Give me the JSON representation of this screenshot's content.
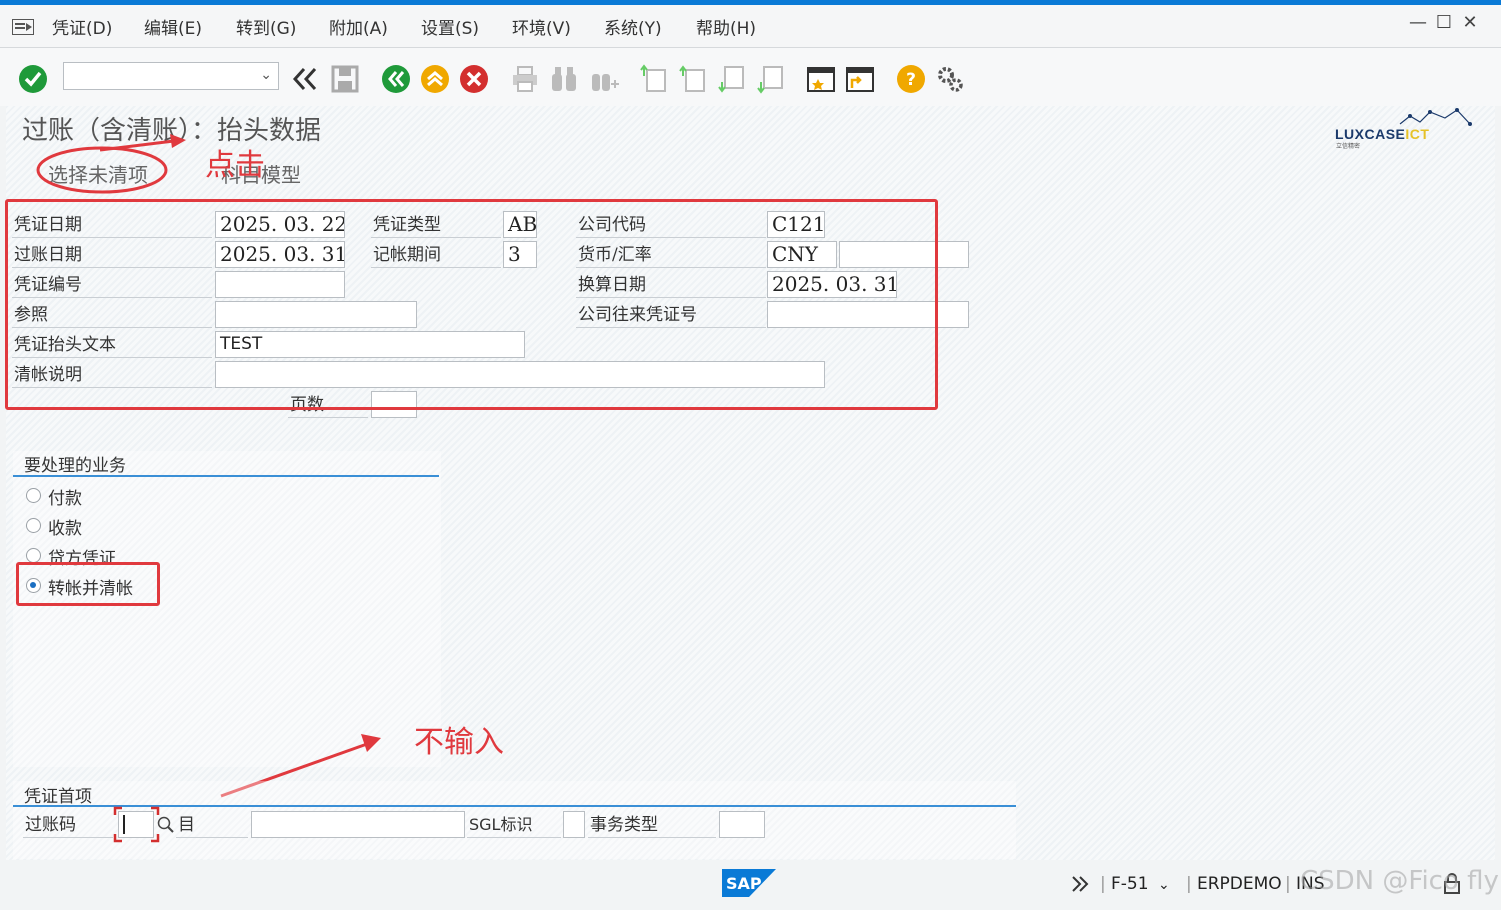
{
  "menubar": {
    "items": [
      "凭证(D)",
      "编辑(E)",
      "转到(G)",
      "附加(A)",
      "设置(S)",
      "环境(V)",
      "系统(Y)",
      "帮助(H)"
    ]
  },
  "toolbar": {
    "command_field_value": "",
    "icons": [
      "enter-icon",
      "back-double-icon",
      "save-icon",
      "back-icon",
      "exit-icon",
      "cancel-icon",
      "print-icon",
      "find-icon",
      "find-next-icon",
      "first-page-icon",
      "prev-page-icon",
      "next-page-icon",
      "last-page-icon",
      "create-session-icon",
      "shortcut-icon",
      "help-icon",
      "settings-icon"
    ]
  },
  "page": {
    "title": "过账（含清账）：抬头数据",
    "logo": {
      "brand": "LUXCASE",
      "brand_suffix": "ICT",
      "sub": "立信精密"
    },
    "app_buttons": [
      "选择未清项",
      "科目模型"
    ]
  },
  "header_fields": {
    "doc_date": {
      "label": "凭证日期",
      "value": "2025. 03. 22"
    },
    "doc_type": {
      "label": "凭证类型",
      "value": "AB"
    },
    "company_code": {
      "label": "公司代码",
      "value": "C121"
    },
    "posting_date": {
      "label": "过账日期",
      "value": "2025. 03. 31"
    },
    "period": {
      "label": "记帐期间",
      "value": "3"
    },
    "currency": {
      "label": "货币/汇率",
      "value": "CNY",
      "rate": ""
    },
    "doc_number": {
      "label": "凭证编号",
      "value": ""
    },
    "translation_date": {
      "label": "换算日期",
      "value": "2025. 03. 31"
    },
    "reference": {
      "label": "参照",
      "value": ""
    },
    "intercompany": {
      "label": "公司往来凭证号",
      "value": ""
    },
    "header_text": {
      "label": "凭证抬头文本",
      "value": "TEST"
    },
    "clearing_text": {
      "label": "清帐说明",
      "value": ""
    },
    "pages": {
      "label": "页数",
      "value": ""
    }
  },
  "transaction": {
    "title": "要处理的业务",
    "options": [
      "付款",
      "收款",
      "贷方凭证",
      "转帐并清帐"
    ],
    "selected": "转帐并清帐"
  },
  "first_item": {
    "title": "凭证首项",
    "posting_key_label": "过账码",
    "posting_key_value": "",
    "account_label": "目",
    "account_value": "",
    "sgl_label": "SGL标识",
    "sgl_value": "",
    "trans_type_label": "事务类型",
    "trans_type_value": ""
  },
  "annotations": {
    "click": "点击",
    "no_input": "不输入"
  },
  "statusbar": {
    "tcode": "F-51",
    "system": "ERPDEMO",
    "mode": "INS",
    "watermark": "CSDN @Fico fly"
  },
  "colors": {
    "accent": "#0a7ad6",
    "annotation": "#e0393e",
    "groupline": "#3a8fd6"
  }
}
